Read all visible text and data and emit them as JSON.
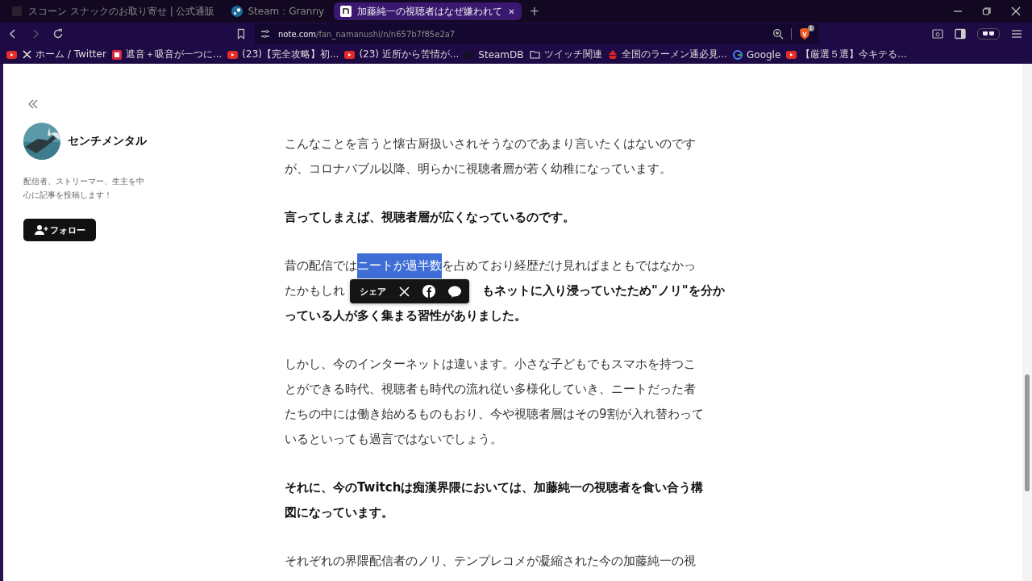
{
  "tabs": [
    {
      "title": "スコーン スナックのお取り寄せ | 公式通販",
      "kind": "blank",
      "selected": false
    },
    {
      "title": "Steam：Granny",
      "kind": "steam",
      "selected": false
    },
    {
      "title": "加藤純一の視聴者はなぜ嫌われて",
      "kind": "note",
      "selected": true,
      "close": "✕"
    }
  ],
  "new_tab": "+",
  "address": {
    "host": "note.com",
    "path": "/fan_namanushi/n/n657b7f85e2a7"
  },
  "shields_count": "1",
  "bookmarks": [
    {
      "kind": "youtube"
    },
    {
      "label": "ホーム / Twitter",
      "kind": "x"
    },
    {
      "label": "遮音＋吸音が一つに...",
      "kind": "app"
    },
    {
      "label": "(23)【完全攻略】初...",
      "kind": "youtube"
    },
    {
      "label": "(23) 近所から苦情が...",
      "kind": "youtube"
    },
    {
      "label": "SteamDB",
      "kind": "dark"
    },
    {
      "label": "ツイッチ関連",
      "kind": "folder"
    },
    {
      "label": "全国のラーメン通必見...",
      "kind": "ramen"
    },
    {
      "label": "Google",
      "kind": "google"
    },
    {
      "label": "【厳選５選】今キテる...",
      "kind": "youtube"
    }
  ],
  "author": {
    "name": "センチメンタル",
    "bio": "配信者、ストリーマー、生主を中心に記事を投稿します！",
    "follow": "フォロー"
  },
  "article": [
    {
      "kind": "text",
      "bold": false,
      "text": "こんなことを言うと懐古厨扱いされそうなのであまり言いたくはないのですが、コロナバブル以降、明らかに視聴者層が若く幼稚になっています。"
    },
    {
      "kind": "text",
      "bold": true,
      "text": "言ってしまえば、視聴者層が広くなっているのです。"
    },
    {
      "kind": "lines",
      "lines": [
        [
          {
            "text": "昔の配信では",
            "bold": false,
            "selected": false
          },
          {
            "text": "ニートが過半数",
            "bold": false,
            "selected": true
          },
          {
            "text": "を占めており経歴だけ見ればまともではなかっ",
            "bold": false,
            "selected": false
          }
        ],
        [
          {
            "text": "たかもしれ",
            "bold": false,
            "selected": false
          },
          {
            "text": "もネットに入り浸っていたため\"ノリ\"を分か",
            "bold": true,
            "selected": false
          }
        ],
        [
          {
            "text": "っている人が多く集まる習性がありました。",
            "bold": true,
            "selected": false
          }
        ]
      ],
      "share": {
        "label": "シェア"
      }
    },
    {
      "kind": "text",
      "bold": false,
      "text": "しかし、今のインターネットは違います。小さな子どもでもスマホを持つことができる時代、視聴者も時代の流れ従い多様化していき、ニートだった者たちの中には働き始めるものもおり、今や視聴者層はその9割が入れ替わっているといっても過言ではないでしょう。"
    },
    {
      "kind": "text",
      "bold": true,
      "text": "それに、今のTwitchは痴漢界隈においては、加藤純一の視聴者を食い合う構図になっています。"
    },
    {
      "kind": "text",
      "bold": false,
      "text": "それぞれの界隈配信者のノリ、テンプレコメが凝縮された今の加藤純一の視"
    }
  ]
}
